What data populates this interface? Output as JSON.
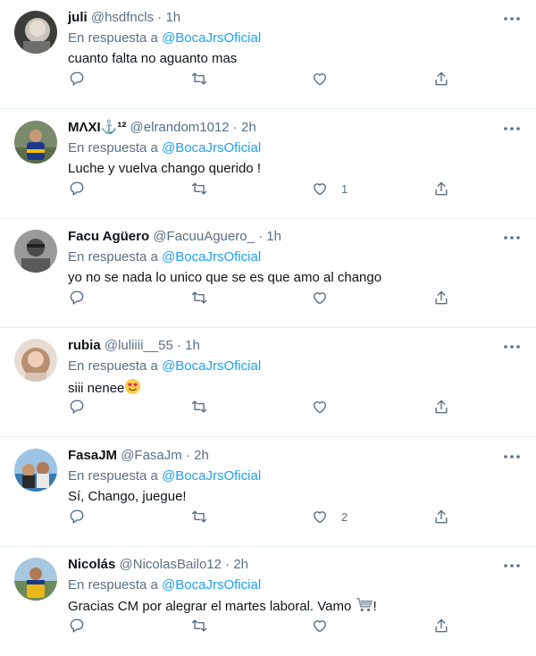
{
  "reply_prefix": "En respuesta a",
  "reply_to": "@BocaJrsOficial",
  "dot": "·",
  "tweets": [
    {
      "name": "juli",
      "handle": "@hsdfncls",
      "time": "1h",
      "text": "cuanto falta no aguanto mas",
      "likes": ""
    },
    {
      "name": "ΜΛΧI⚓¹²",
      "handle": "@elrandom1012",
      "time": "2h",
      "text": "Luche y vuelva chango querido !",
      "likes": "1"
    },
    {
      "name": "Facu Agüero",
      "handle": "@FacuuAguero_",
      "time": "1h",
      "text": "yo no se nada lo unico que se es que amo al chango",
      "likes": ""
    },
    {
      "name": "rubia",
      "handle": "@luliiii__55",
      "time": "1h",
      "text": "siii nenee",
      "likes": ""
    },
    {
      "name": "FasaJM",
      "handle": "@FasaJm",
      "time": "2h",
      "text": "Sí, Chango, juegue!",
      "likes": "2"
    },
    {
      "name": "Nicolás",
      "handle": "@NicolasBailo12",
      "time": "2h",
      "text": "Gracias CM por alegrar el martes laboral. Vamo",
      "text_suffix": "!",
      "likes": ""
    }
  ],
  "icons": {
    "more": "more-horizontal-icon",
    "reply": "reply-icon",
    "retweet": "retweet-icon",
    "like": "heart-icon",
    "share": "share-icon",
    "emoji_heart_eyes": "heart-eyes-emoji",
    "emoji_cart": "shopping-cart-emoji"
  },
  "colors": {
    "text": "#0f1419",
    "secondary": "#5b7083",
    "mention": "#1da1f2",
    "divider": "#e6ecf0"
  }
}
